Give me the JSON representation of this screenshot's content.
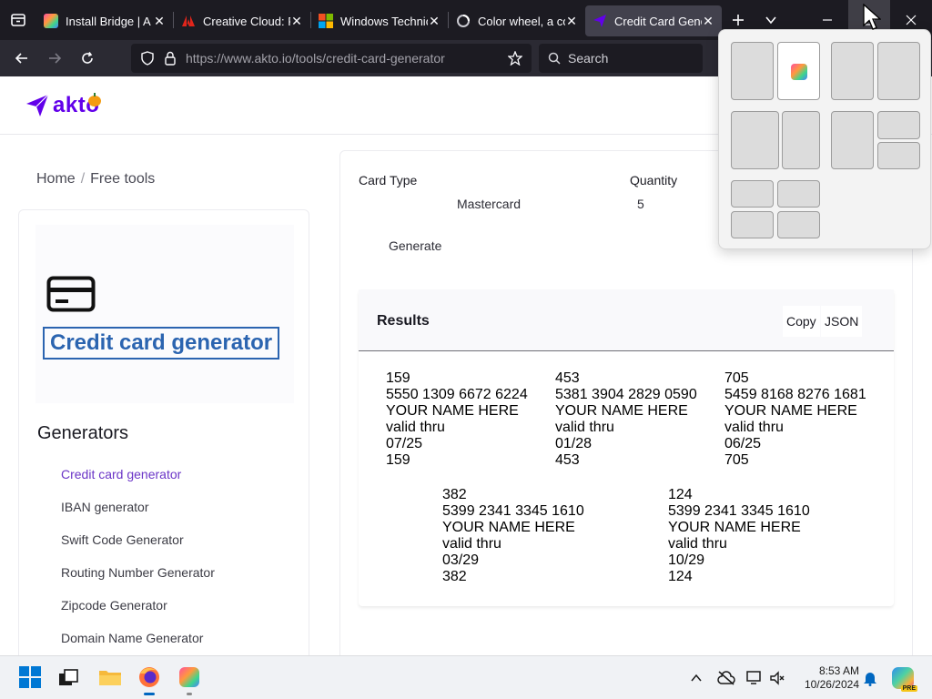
{
  "browser": {
    "tabs": [
      {
        "title": "Install Bridge | A",
        "favicon": "creative-cloud-icon",
        "color": "#e8366d"
      },
      {
        "title": "Creative Cloud: F",
        "favicon": "adobe-icon",
        "color": "#e1251b"
      },
      {
        "title": "Windows Technic",
        "favicon": "windows-icon",
        "color": "#f25022"
      },
      {
        "title": "Color wheel, a co",
        "favicon": "color-wheel-icon",
        "color": "#3d3d3d"
      },
      {
        "title": "Credit Card Gene",
        "favicon": "akto-icon",
        "color": "#6200ea",
        "active": true
      }
    ],
    "url": "https://www.akto.io/tools/credit-card-generator",
    "search_placeholder": "Search"
  },
  "site": {
    "logo_text": "akto",
    "brand_color": "#6200ea"
  },
  "breadcrumb": {
    "home": "Home",
    "separator": "/",
    "current": "Free tools"
  },
  "sidebar": {
    "tool_title": "Credit card generator",
    "section_heading": "Generators",
    "items": [
      {
        "label": "Credit card generator",
        "active": true
      },
      {
        "label": "IBAN generator"
      },
      {
        "label": "Swift Code Generator"
      },
      {
        "label": "Routing Number Generator"
      },
      {
        "label": "Zipcode Generator"
      },
      {
        "label": "Domain Name Generator"
      }
    ]
  },
  "form": {
    "card_type_label": "Card Type",
    "card_type_value": "Mastercard",
    "quantity_label": "Quantity",
    "quantity_value": "5",
    "generate_label": "Generate"
  },
  "results": {
    "title": "Results",
    "copy_label": "Copy",
    "json_label": "JSON",
    "cards": [
      {
        "cvv": "159",
        "number": "5550 1309 6672 6224",
        "name": "YOUR NAME HERE",
        "valid": "valid thru",
        "expiry": "07/25"
      },
      {
        "cvv": "453",
        "number": "5381 3904 2829 0590",
        "name": "YOUR NAME HERE",
        "valid": "valid thru",
        "expiry": "01/28"
      },
      {
        "cvv": "705",
        "number": "5459 8168 8276 1681",
        "name": "YOUR NAME HERE",
        "valid": "valid thru",
        "expiry": "06/25"
      },
      {
        "cvv": "382",
        "number": "5399 2341 3345 1610",
        "name": "YOUR NAME HERE",
        "valid": "valid thru",
        "expiry": "03/29"
      },
      {
        "cvv": "124",
        "number": "5399 2341 3345 1610",
        "name": "YOUR NAME HERE",
        "valid": "valid thru",
        "expiry": "10/29"
      }
    ]
  },
  "taskbar": {
    "time": "8:53 AM",
    "date": "10/26/2024",
    "tray_badge": "PRE"
  }
}
